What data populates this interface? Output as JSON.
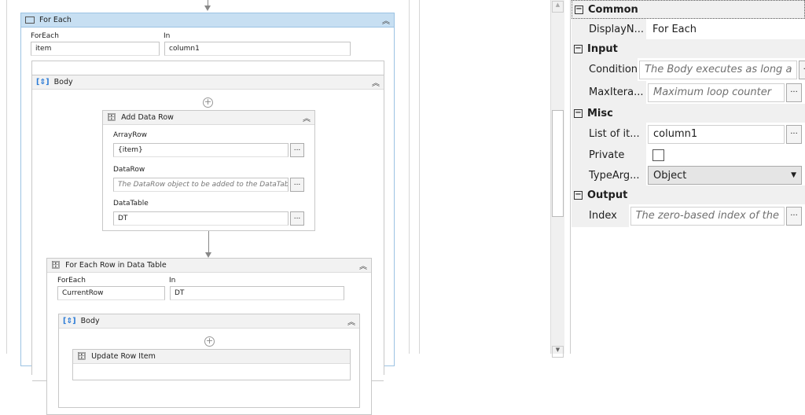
{
  "for_each": {
    "title": "For Each",
    "foreach_label": "ForEach",
    "foreach_value": "item",
    "in_label": "In",
    "in_value": "column1",
    "body": {
      "title": "Body",
      "add_data_row": {
        "title": "Add Data Row",
        "arrayrow_label": "ArrayRow",
        "arrayrow_value": "{item}",
        "datarow_label": "DataRow",
        "datarow_placeholder": "The DataRow object to be added to the DataTable.",
        "datatable_label": "DataTable",
        "datatable_value": "DT",
        "ellipsis": "..."
      },
      "for_each_row": {
        "title": "For Each Row in Data Table",
        "foreach_label": "ForEach",
        "foreach_value": "CurrentRow",
        "in_label": "In",
        "in_value": "DT",
        "body": {
          "title": "Body",
          "child_title": "Update Row Item"
        }
      }
    }
  },
  "properties": {
    "common": {
      "label": "Common",
      "display_name_label": "DisplayN...",
      "display_name_value": "For Each"
    },
    "input": {
      "label": "Input",
      "condition_label": "Condition",
      "condition_placeholder": "The Body executes as long a",
      "maxiter_label": "MaxItera...",
      "maxiter_placeholder": "Maximum loop counter"
    },
    "misc": {
      "label": "Misc",
      "list_label": "List of it...",
      "list_value": "column1",
      "private_label": "Private",
      "typearg_label": "TypeArg...",
      "typearg_value": "Object"
    },
    "output": {
      "label": "Output",
      "index_label": "Index",
      "index_placeholder": "The zero-based index of the"
    },
    "collapse_glyph": "−",
    "ellipsis": "...",
    "dropdown_glyph": "▼"
  }
}
